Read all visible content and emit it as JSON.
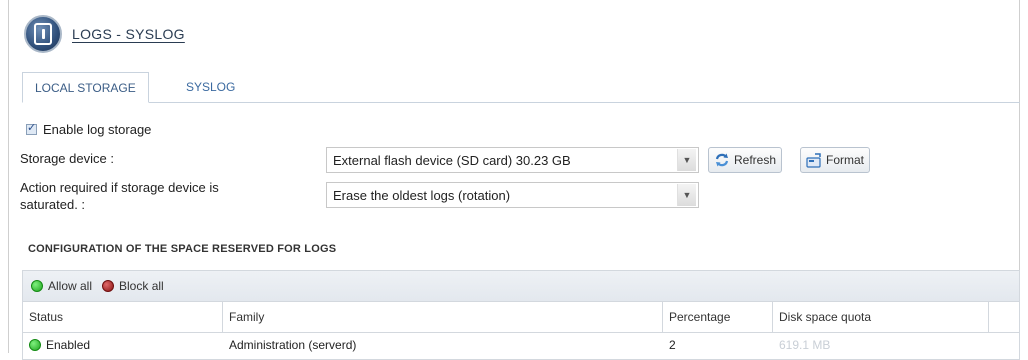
{
  "header": {
    "title": "LOGS - SYSLOG",
    "icon": "log-module-icon"
  },
  "tabs": [
    {
      "label": "LOCAL STORAGE",
      "active": true
    },
    {
      "label": "SYSLOG",
      "active": false
    }
  ],
  "form": {
    "enable_label": "Enable log storage",
    "enable_checked": true,
    "storage_device_label": "Storage device :",
    "storage_device_value": "External flash device (SD card) 30.23 GB",
    "refresh_label": "Refresh",
    "format_label": "Format",
    "action_label_line1": "Action required if storage device is",
    "action_label_line2": "saturated. :",
    "action_value": "Erase the oldest logs (rotation)"
  },
  "space_config": {
    "title": "CONFIGURATION OF THE SPACE RESERVED FOR LOGS",
    "toolbar": {
      "allow_all": "Allow all",
      "block_all": "Block all"
    },
    "columns": [
      "Status",
      "Family",
      "Percentage",
      "Disk space quota"
    ],
    "rows": [
      {
        "status": "Enabled",
        "family": "Administration (serverd)",
        "percentage": "2",
        "quota": "619.1 MB"
      }
    ]
  },
  "colors": {
    "accent": "#3b6aa0",
    "enabled": "#1fa51f",
    "blocked": "#8a1212"
  }
}
